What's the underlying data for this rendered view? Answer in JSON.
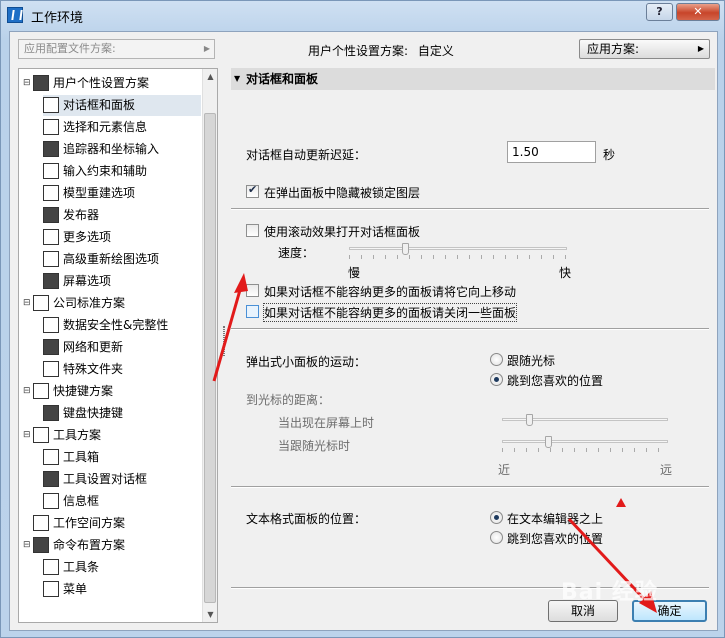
{
  "window": {
    "title": "工作环境",
    "help_label": "?",
    "close_label": "✕"
  },
  "top": {
    "profile_dropdown_placeholder": "应用配置文件方案:",
    "profile_label": "用户个性设置方案:",
    "profile_value": "自定义",
    "apply_label": "应用方案:"
  },
  "tree": [
    {
      "label": "用户个性设置方案",
      "level": 0,
      "expanded": true
    },
    {
      "label": "对话框和面板",
      "level": 1,
      "selected": true
    },
    {
      "label": "选择和元素信息",
      "level": 1
    },
    {
      "label": "追踪器和坐标输入",
      "level": 1
    },
    {
      "label": "输入约束和辅助",
      "level": 1
    },
    {
      "label": "模型重建选项",
      "level": 1
    },
    {
      "label": "发布器",
      "level": 1
    },
    {
      "label": "更多选项",
      "level": 1
    },
    {
      "label": "高级重新绘图选项",
      "level": 1
    },
    {
      "label": "屏幕选项",
      "level": 1
    },
    {
      "label": "公司标准方案",
      "level": 0,
      "expanded": true
    },
    {
      "label": "数据安全性&完整性",
      "level": 1
    },
    {
      "label": "网络和更新",
      "level": 1
    },
    {
      "label": "特殊文件夹",
      "level": 1
    },
    {
      "label": "快捷键方案",
      "level": 0,
      "expanded": true
    },
    {
      "label": "键盘快捷键",
      "level": 1
    },
    {
      "label": "工具方案",
      "level": 0,
      "expanded": true
    },
    {
      "label": "工具箱",
      "level": 1
    },
    {
      "label": "工具设置对话框",
      "level": 1
    },
    {
      "label": "信息框",
      "level": 1
    },
    {
      "label": "工作空间方案",
      "level": 0
    },
    {
      "label": "命令布置方案",
      "level": 0,
      "expanded": true
    },
    {
      "label": "工具条",
      "level": 1
    },
    {
      "label": "菜单",
      "level": 1
    }
  ],
  "panel": {
    "section_title": "对话框和面板",
    "delay_label": "对话框自动更新迟延：",
    "delay_value": "1.50",
    "delay_unit": "秒",
    "hide_locked_label": "在弹出面板中隐藏被锁定图层",
    "hide_locked_checked": true,
    "scroll_effect_label": "使用滚动效果打开对话框面板",
    "scroll_effect_checked": false,
    "speed_label": "速度：",
    "speed_min": "慢",
    "speed_max": "快",
    "speed_level": 0.25,
    "move_up_label": "如果对话框不能容纳更多的面板请将它向上移动",
    "move_up_checked": false,
    "close_some_label": "如果对话框不能容纳更多的面板请关闭一些面板",
    "close_some_checked": false,
    "popup_motion_label": "弹出式小面板的运动：",
    "popup_follow_label": "跟随光标",
    "popup_preferred_label": "跳到您喜欢的位置",
    "popup_selected": "preferred",
    "distance_label": "到光标的距离：",
    "dist_screen_label": "当出现在屏幕上时",
    "dist_follow_label": "当跟随光标时",
    "dist_screen_level": 0.15,
    "dist_follow_level": 0.27,
    "near_label": "近",
    "far_label": "远",
    "text_format_label": "文本格式面板的位置：",
    "text_above_label": "在文本编辑器之上",
    "text_preferred_label": "跳到您喜欢的位置",
    "text_selected": "above"
  },
  "buttons": {
    "cancel": "取消",
    "ok": "确定"
  },
  "accent_colors": {
    "annotation_red": "#e21a1a",
    "selection": "#dfe7ef"
  }
}
